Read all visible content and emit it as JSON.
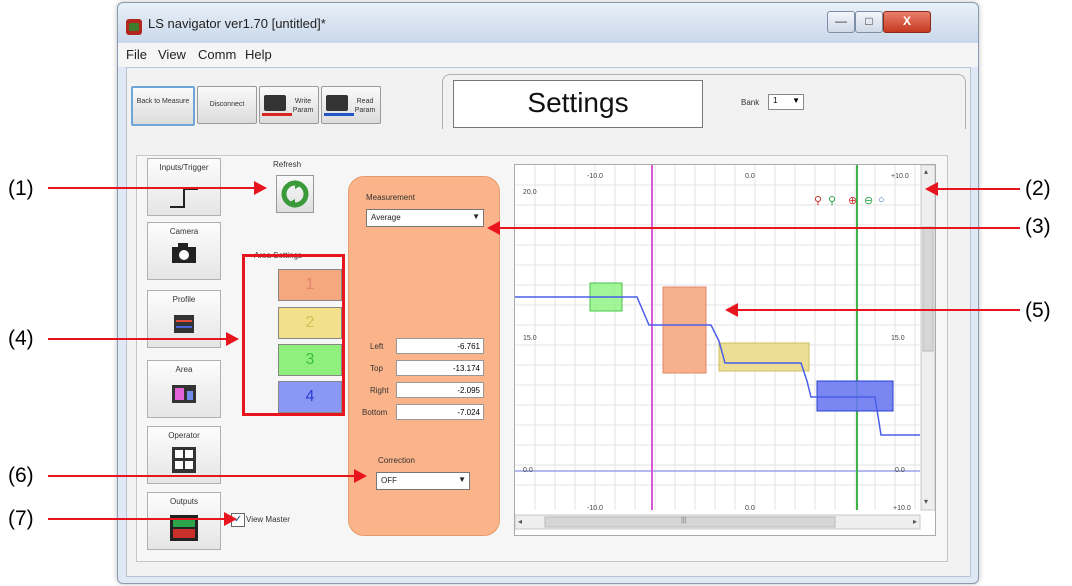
{
  "window": {
    "title": "LS navigator ver1.70 [untitled]*",
    "min_glyph": "—",
    "max_glyph": "□",
    "close_glyph": "X"
  },
  "menu": [
    "File",
    "View",
    "Comm",
    "Help"
  ],
  "toolbar": {
    "back_label": "Back to Measure",
    "disconnect_label": "Disconnect",
    "write_label": "Write Param",
    "read_label": "Read Param"
  },
  "header": {
    "title": "Settings",
    "bank_label": "Bank",
    "bank_value": "1"
  },
  "side_tabs": [
    "Inputs/Trigger",
    "Camera",
    "Profile",
    "Area",
    "Operator",
    "Outputs"
  ],
  "refresh_label": "Refresh",
  "area_settings": {
    "label": "Area Settings",
    "items": [
      "1",
      "2",
      "3",
      "4"
    ],
    "colors": [
      "#f5a77e",
      "#f2e08a",
      "#8ff07d",
      "#8a97f5"
    ]
  },
  "measurement": {
    "label": "Measurement",
    "value": "Average"
  },
  "coords": {
    "labels": [
      "Left",
      "Top",
      "Right",
      "Bottom"
    ],
    "values": [
      "-6.761",
      "-13.174",
      "-2.095",
      "-7.024"
    ]
  },
  "correction": {
    "label": "Correction",
    "value": "OFF"
  },
  "view_master": {
    "label": "View Master",
    "checked": true
  },
  "graph": {
    "x_ticks_top": [
      "-10.0",
      "0.0",
      "+10.0"
    ],
    "x_ticks_bottom": [
      "-10.0",
      "0.0",
      "+10.0"
    ],
    "y_ticks_left": [
      "20.0",
      "15.0",
      "0.0"
    ],
    "y_ticks_right": [
      "15.0",
      "0.0"
    ],
    "scroll_left_glyph": "◂",
    "scroll_right_glyph": "▸",
    "scroll_up_glyph": "▴",
    "scroll_down_glyph": "▾",
    "scroll_grip": "|||"
  },
  "callouts": [
    "(1)",
    "(2)",
    "(3)",
    "(4)",
    "(5)",
    "(6)",
    "(7)"
  ]
}
